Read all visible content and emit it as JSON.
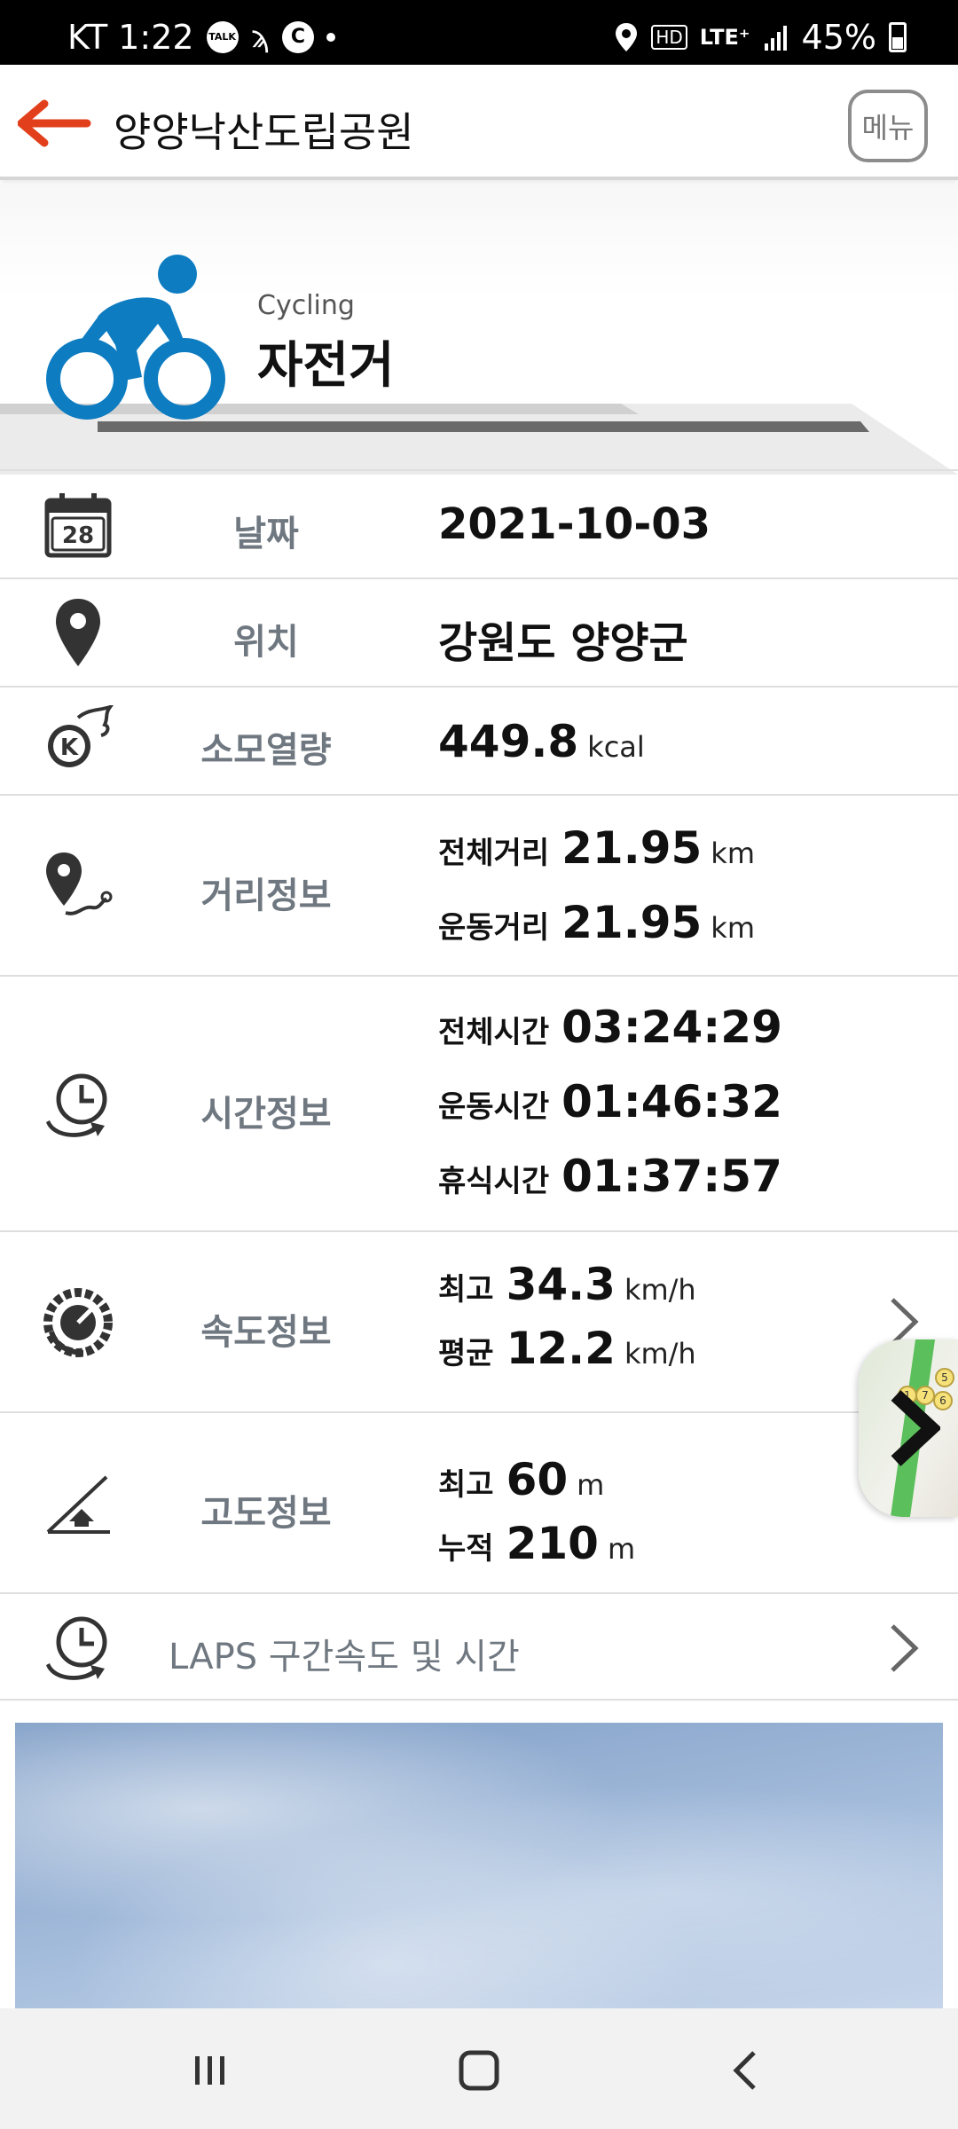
{
  "status_bar": {
    "carrier_time": "KT 1:22",
    "icons": [
      "talk-icon",
      "swirl-icon",
      "c-icon",
      "dot-icon"
    ],
    "talk_label": "TALK",
    "c_label": "C",
    "hd_label": "HD",
    "network": "LTE⁺",
    "battery": "45%"
  },
  "header": {
    "title": "양양낙산도립공원",
    "menu_label": "메뉴"
  },
  "activity": {
    "en": "Cycling",
    "ko": "자전거",
    "accent_color": "#0d7cc1"
  },
  "rows": {
    "date": {
      "label": "날짜",
      "icon_day": "28",
      "value": "2021-10-03"
    },
    "location": {
      "label": "위치",
      "value": "강원도 양양군"
    },
    "calories": {
      "label": "소모열량",
      "icon_letter": "K",
      "value": "449.8",
      "unit": "kcal"
    },
    "distance": {
      "label": "거리정보",
      "total_label": "전체거리",
      "total_value": "21.95",
      "total_unit": "km",
      "moving_label": "운동거리",
      "moving_value": "21.95",
      "moving_unit": "km"
    },
    "time": {
      "label": "시간정보",
      "total_label": "전체시간",
      "total_value": "03:24:29",
      "moving_label": "운동시간",
      "moving_value": "01:46:32",
      "rest_label": "휴식시간",
      "rest_value": "01:37:57"
    },
    "speed": {
      "label": "속도정보",
      "max_label": "최고",
      "max_value": "34.3",
      "max_unit": "km/h",
      "avg_label": "평균",
      "avg_value": "12.2",
      "avg_unit": "km/h"
    },
    "altitude": {
      "label": "고도정보",
      "max_label": "최고",
      "max_value": "60",
      "max_unit": "m",
      "cum_label": "누적",
      "cum_value": "210",
      "cum_unit": "m"
    },
    "laps": {
      "label": "LAPS 구간속도 및 시간"
    }
  },
  "map_thumb": {
    "pins": [
      "5",
      "1",
      "7",
      "6",
      "5"
    ]
  }
}
